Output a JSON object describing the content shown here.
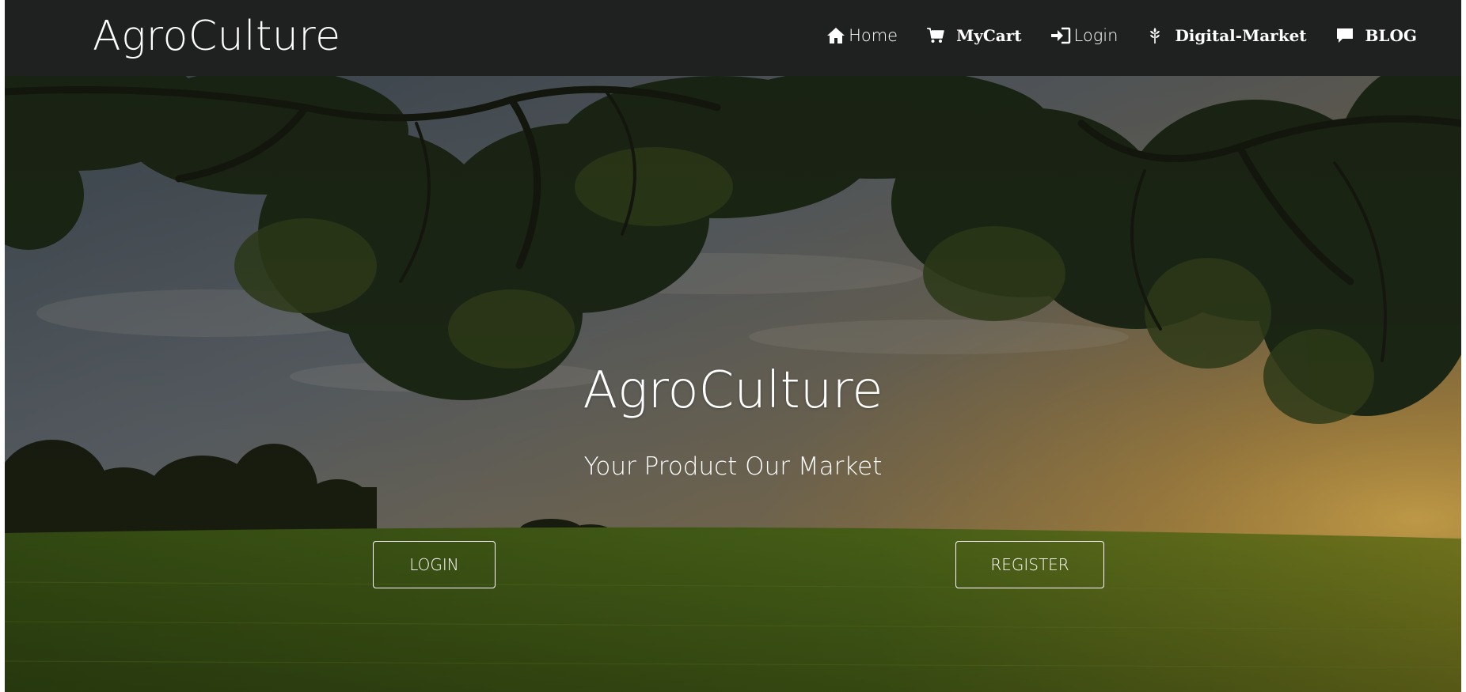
{
  "brand": "AgroCulture",
  "nav": {
    "items": [
      {
        "label": "Home",
        "icon": "home-icon",
        "style": "sans"
      },
      {
        "label": "MyCart",
        "icon": "cart-icon",
        "style": "serif"
      },
      {
        "label": "Login",
        "icon": "login-icon",
        "style": "sans"
      },
      {
        "label": "Digital-Market",
        "icon": "grain-icon",
        "style": "serif"
      },
      {
        "label": "BLOG",
        "icon": "comment-icon",
        "style": "serif"
      }
    ]
  },
  "hero": {
    "title": "AgroCulture",
    "subtitle": "Your Product Our Market",
    "login_label": "LOGIN",
    "register_label": "REGISTER"
  },
  "colors": {
    "navbar": "#1f2120",
    "text": "#ffffff",
    "sky_top": "#5d6a72",
    "sunset": "#b9903e",
    "grass": "#4c6a18"
  }
}
